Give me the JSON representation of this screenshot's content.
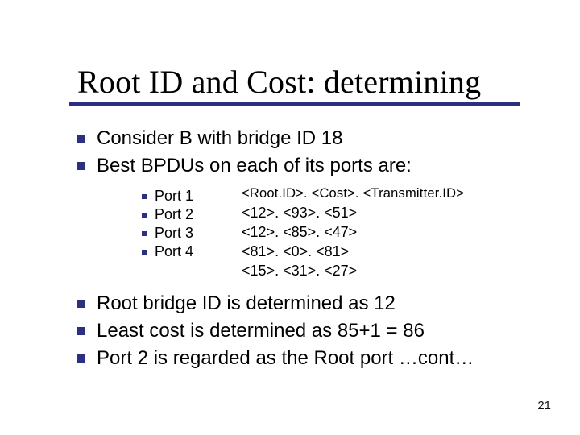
{
  "title": "Root ID and Cost: determining",
  "intro": [
    "Consider B with bridge ID 18",
    "Best BPDUs on each of its ports are:"
  ],
  "bpdu_header": "<Root.ID>. <Cost>. <Transmitter.ID>",
  "ports": [
    {
      "label": "Port 1",
      "bpdu": "<12>. <93>. <51>"
    },
    {
      "label": "Port 2",
      "bpdu": "<12>. <85>. <47>"
    },
    {
      "label": "Port 3",
      "bpdu": "<81>. <0>. <81>"
    },
    {
      "label": "Port 4",
      "bpdu": "<15>. <31>. <27>"
    }
  ],
  "conclusions": [
    "Root bridge ID is determined as 12",
    "Least cost is determined as 85+1 = 86",
    "Port 2 is regarded as the Root port …cont…"
  ],
  "page_number": "21"
}
